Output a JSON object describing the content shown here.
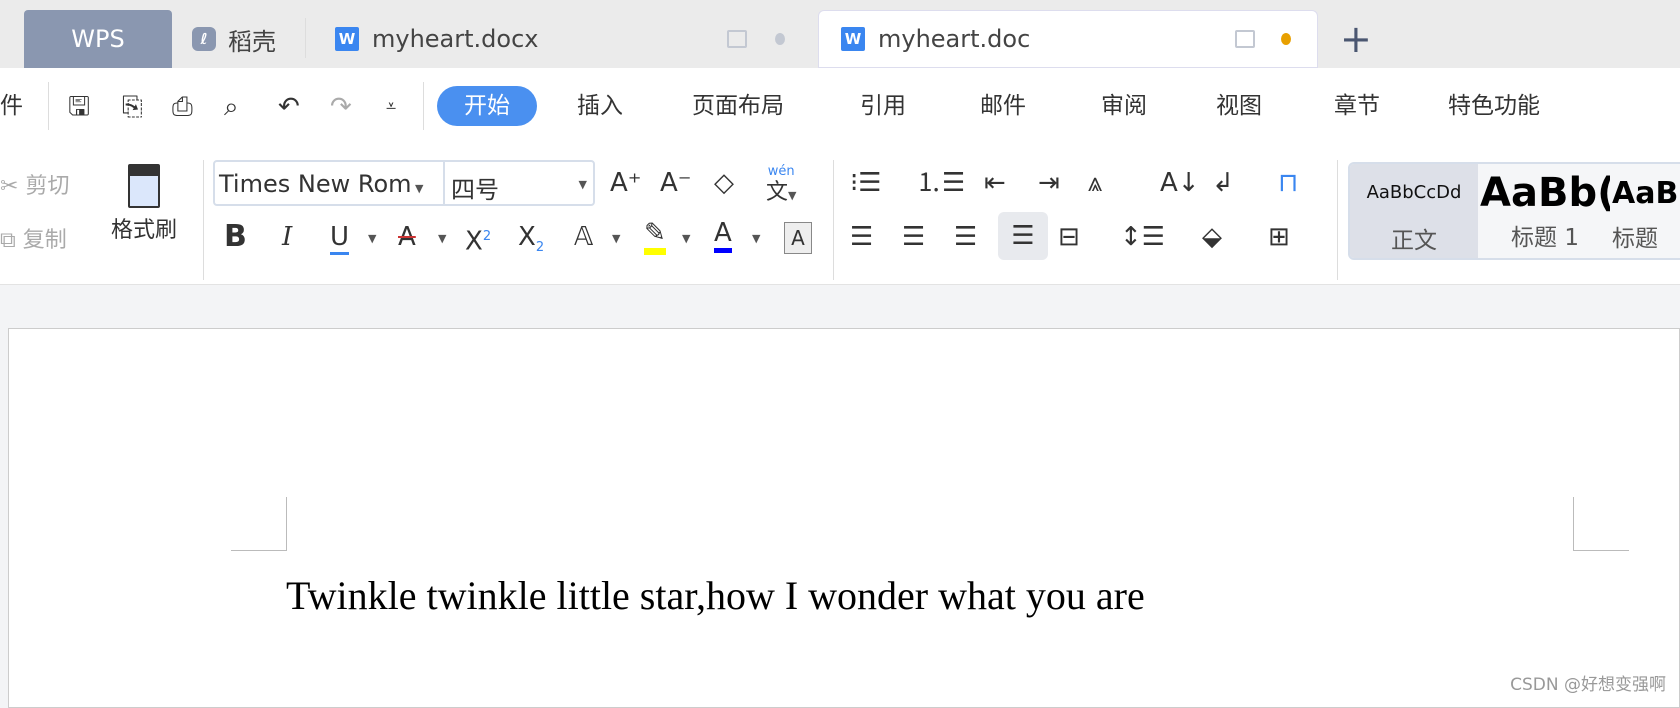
{
  "tabs": {
    "wps": "WPS",
    "docer": "稻壳",
    "doc1": "myheart.docx",
    "doc2": "myheart.doc",
    "new_tab": "+"
  },
  "menu": {
    "partial": "件",
    "items": [
      "开始",
      "插入",
      "页面布局",
      "引用",
      "邮件",
      "审阅",
      "视图",
      "章节",
      "特色功能"
    ]
  },
  "clipboard": {
    "cut": "剪切",
    "copy": "复制",
    "format_painter": "格式刷"
  },
  "font": {
    "family": "Times New Rom",
    "size": "四号"
  },
  "styles": {
    "normal_preview": "AaBbCcDd",
    "normal": "正文",
    "h1_preview": "AaBb(",
    "h1": "标题 1",
    "h2_preview": "AaBl",
    "h2": "标题"
  },
  "document": {
    "text": "Twinkle twinkle little star,how I wonder what you are"
  },
  "watermark": "CSDN @好想变强啊",
  "colors": {
    "accent": "#4a90f0",
    "modified_dot": "#e8a000",
    "highlight": "#ffff00",
    "font_color": "#0000ff"
  }
}
